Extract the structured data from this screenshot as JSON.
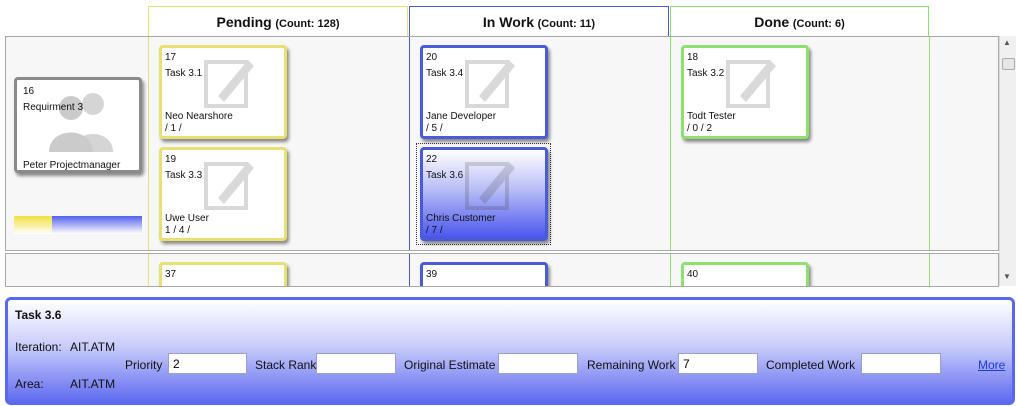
{
  "columns": [
    {
      "name": "Pending",
      "count": "(Count: 128)",
      "color": "#e8e070"
    },
    {
      "name": "In Work",
      "count": "(Count: 11)",
      "color": "#4a5bd8"
    },
    {
      "name": "Done",
      "count": "(Count: 6)",
      "color": "#90e070"
    }
  ],
  "requirement": {
    "id": "16",
    "title": "Requirment 3",
    "owner": "Peter Projectmanager"
  },
  "cards": {
    "c17": {
      "id": "17",
      "title": "Task 3.1",
      "person": "Neo Nearshore",
      "nums": " / 1 /"
    },
    "c19": {
      "id": "19",
      "title": "Task 3.3",
      "person": "Uwe User",
      "nums": "1 / 4 /"
    },
    "c20": {
      "id": "20",
      "title": "Task 3.4",
      "person": "Jane Developer",
      "nums": " / 5 /"
    },
    "c22": {
      "id": "22",
      "title": "Task 3.6",
      "person": "Chris Customer",
      "nums": " / 7 /"
    },
    "c18": {
      "id": "18",
      "title": "Task 3.2",
      "person": "Todt Tester",
      "nums": " / 0 / 2"
    },
    "c37": {
      "id": "37"
    },
    "c39": {
      "id": "39"
    },
    "c40": {
      "id": "40"
    }
  },
  "detail": {
    "title": "Task 3.6",
    "iteration_label": "Iteration:",
    "iteration_value": "AIT.ATM",
    "area_label": "Area:",
    "area_value": "AIT.ATM",
    "priority_label": "Priority",
    "priority_value": "2",
    "stack_rank_label": "Stack Rank",
    "stack_rank_value": "",
    "original_estimate_label": "Original Estimate",
    "original_estimate_value": "",
    "remaining_work_label": "Remaining Work",
    "remaining_work_value": "7",
    "completed_work_label": "Completed Work",
    "completed_work_value": "",
    "more_label": "More"
  },
  "colors": {
    "pending": "#e8e070",
    "inwork": "#4a5bd8",
    "done": "#90e070",
    "selected_gradient_end": "#4a55ec"
  }
}
